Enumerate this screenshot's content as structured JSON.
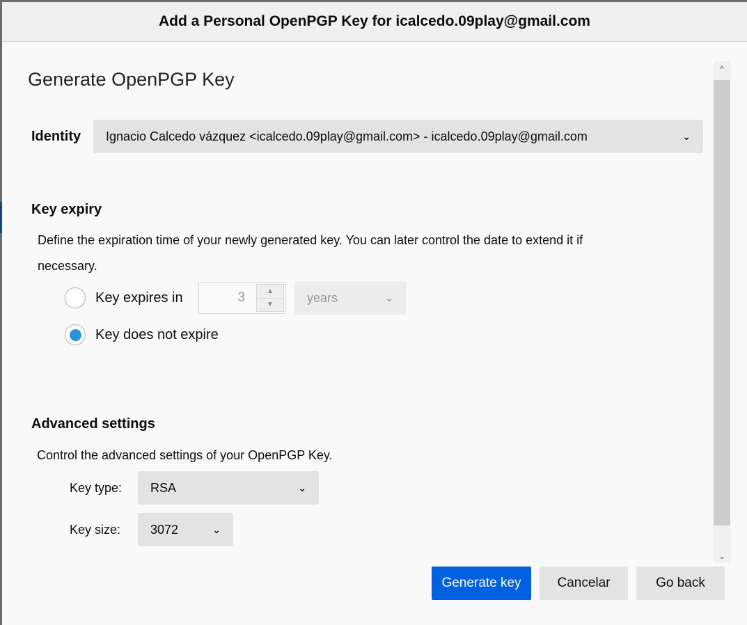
{
  "window": {
    "title": "Add a Personal OpenPGP Key for icalcedo.09play@gmail.com"
  },
  "heading": "Generate OpenPGP Key",
  "identity": {
    "label": "Identity",
    "value": "Ignacio Calcedo vázquez <icalcedo.09play@gmail.com> - icalcedo.09play@gmail.com"
  },
  "expiry": {
    "title": "Key expiry",
    "description": "Define the expiration time of your newly generated key. You can later control the date to extend it if",
    "description2": "necessary.",
    "option_expires": "Key expires in",
    "amount": "3",
    "unit": "years",
    "option_never": "Key does not expire",
    "selected": "never"
  },
  "advanced": {
    "title": "Advanced settings",
    "description": "Control the advanced settings of your OpenPGP Key.",
    "type_label": "Key type:",
    "type_value": "RSA",
    "size_label": "Key size:",
    "size_value": "3072"
  },
  "buttons": {
    "generate": "Generate key",
    "cancel": "Cancelar",
    "back": "Go back"
  }
}
